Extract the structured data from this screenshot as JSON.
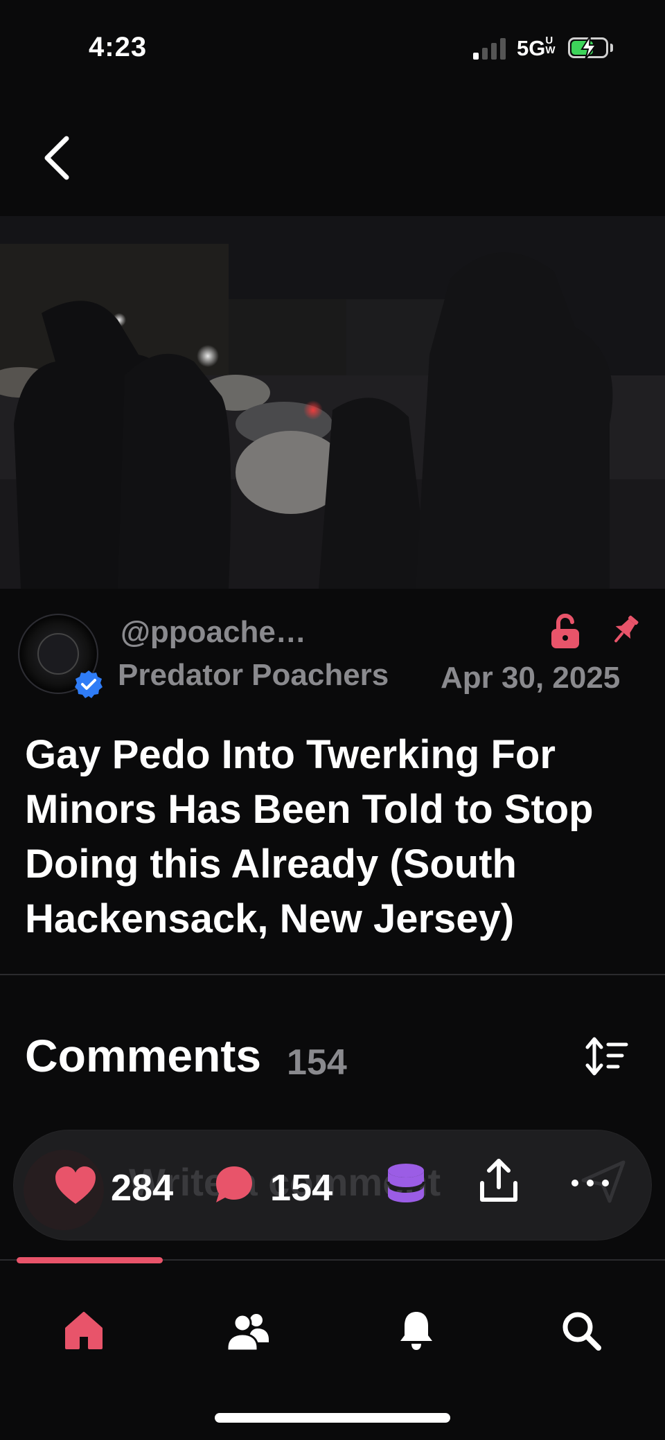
{
  "status_bar": {
    "time": "4:23",
    "network": "5GUW",
    "battery_level": 0.6
  },
  "post": {
    "handle": "@ppoache…",
    "author": "Predator Poachers",
    "date": "Apr 30, 2025",
    "title": "Gay Pedo Into Twerking For Minors Has Been Told to Stop Doing this Already (South Hackensack, New Jersey)",
    "verified": true
  },
  "comments": {
    "heading": "Comments",
    "count": "154"
  },
  "action_bar": {
    "comment_placeholder": "Write a comment",
    "likes": "284",
    "comments": "154"
  },
  "scroll_progress": 0.22,
  "colors": {
    "accent": "#e8546a",
    "verified": "#2f7cf6",
    "coins": "#9b5de5",
    "background": "#0a0a0b"
  },
  "icons": [
    "back-chevron-icon",
    "lock-open-icon",
    "pin-icon",
    "verified-badge-icon",
    "sort-icon",
    "heart-icon",
    "comment-bubble-icon",
    "coins-icon",
    "share-icon",
    "more-dots-icon",
    "home-icon",
    "people-icon",
    "bell-icon",
    "search-icon",
    "send-icon"
  ]
}
